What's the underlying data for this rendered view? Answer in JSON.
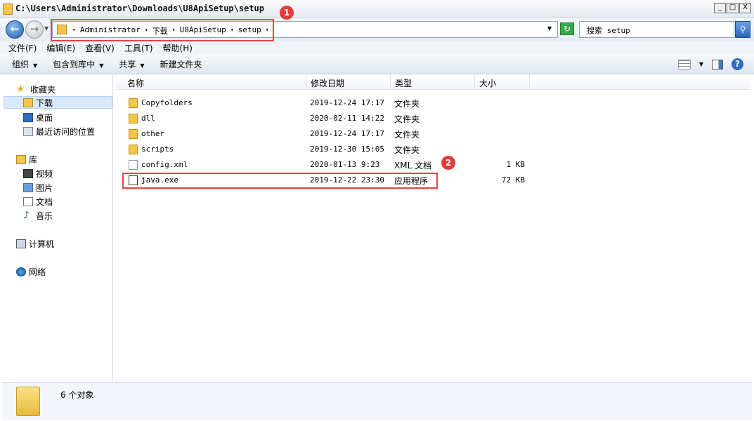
{
  "window": {
    "title": "C:\\Users\\Administrator\\Downloads\\U8ApiSetup\\setup",
    "min_label": "_",
    "max_label": "□",
    "close_label": "X"
  },
  "address": {
    "crumbs": [
      "Administrator",
      "下载",
      "U8ApiSetup",
      "setup"
    ],
    "separator": "▾"
  },
  "search": {
    "placeholder": "搜索 setup"
  },
  "menu": [
    "文件(F)",
    "编辑(E)",
    "查看(V)",
    "工具(T)",
    "帮助(H)"
  ],
  "commands": {
    "organize": "组织",
    "include_library": "包含到库中",
    "share": "共享",
    "new_folder": "新建文件夹"
  },
  "sidebar": {
    "favorites": {
      "label": "收藏夹",
      "items": [
        "下载",
        "桌面",
        "最近访问的位置"
      ]
    },
    "libraries": {
      "label": "库",
      "items": [
        "视频",
        "图片",
        "文档",
        "音乐"
      ]
    },
    "computer": "计算机",
    "network": "网络"
  },
  "columns": {
    "name": "名称",
    "date": "修改日期",
    "type": "类型",
    "size": "大小"
  },
  "files": [
    {
      "name": "Copyfolders",
      "date": "2019-12-24 17:17",
      "type": "文件夹",
      "size": "",
      "kind": "folder"
    },
    {
      "name": "dll",
      "date": "2020-02-11 14:22",
      "type": "文件夹",
      "size": "",
      "kind": "folder"
    },
    {
      "name": "other",
      "date": "2019-12-24 17:17",
      "type": "文件夹",
      "size": "",
      "kind": "folder"
    },
    {
      "name": "scripts",
      "date": "2019-12-30 15:05",
      "type": "文件夹",
      "size": "",
      "kind": "folder"
    },
    {
      "name": "config.xml",
      "date": "2020-01-13 9:23",
      "type": "XML 文档",
      "size": "1 KB",
      "kind": "xml"
    },
    {
      "name": "java.exe",
      "date": "2019-12-22 23:30",
      "type": "应用程序",
      "size": "72 KB",
      "kind": "exe"
    }
  ],
  "annotations": {
    "badge1": "1",
    "badge2": "2"
  },
  "status": {
    "count": "6 个对象"
  },
  "colors": {
    "highlight": "#e84343",
    "badge": "#e23b3b",
    "selection": "#d9e8fb"
  }
}
